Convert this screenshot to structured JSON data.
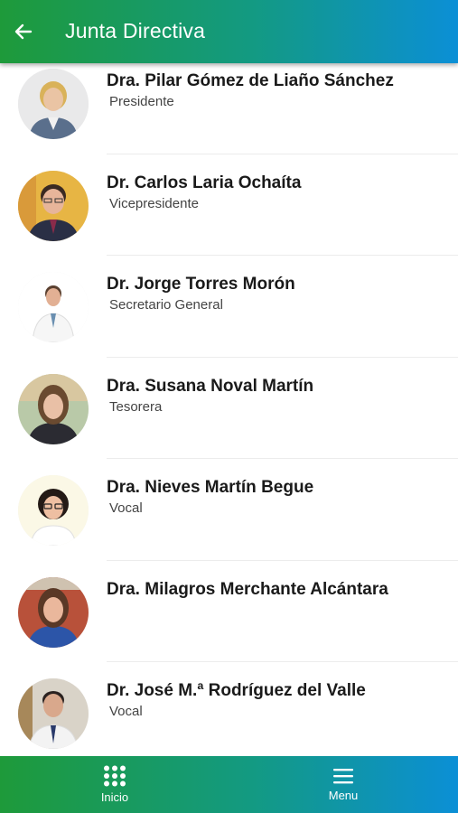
{
  "header": {
    "title": "Junta Directiva",
    "back_icon": "arrow-left-icon"
  },
  "members": [
    {
      "name": "Dra. Pilar Gómez de Liaño Sánchez",
      "role": "Presidente"
    },
    {
      "name": "Dr. Carlos Laria Ochaíta",
      "role": "Vicepresidente"
    },
    {
      "name": "Dr. Jorge Torres Morón",
      "role": "Secretario General"
    },
    {
      "name": "Dra. Susana Noval Martín",
      "role": "Tesorera"
    },
    {
      "name": "Dra. Nieves Martín Begue",
      "role": "Vocal"
    },
    {
      "name": "Dra. Milagros Merchante Alcántara",
      "role": ""
    },
    {
      "name": "Dr. José M.ª Rodríguez del Valle",
      "role": "Vocal"
    }
  ],
  "bottom_nav": {
    "home_label": "Inicio",
    "home_icon": "grid-icon",
    "menu_label": "Menu",
    "menu_icon": "hamburger-icon"
  },
  "colors": {
    "gradient_start": "#1e9a3a",
    "gradient_end": "#0b8fd6"
  }
}
